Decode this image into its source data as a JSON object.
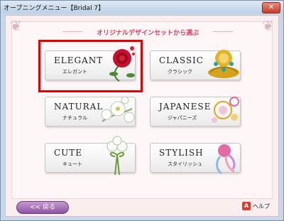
{
  "window": {
    "title": "オープニングメニュー【Bridal 7】",
    "close_label": "✕"
  },
  "heading": "オリジナルデザインセットから選ぶ",
  "tiles": [
    {
      "title": "ELEGANT",
      "subtitle": "エレガント",
      "selected": true,
      "icon": "red-rose-icon",
      "accent": "#c8102e"
    },
    {
      "title": "CLASSIC",
      "subtitle": "クラシック",
      "selected": false,
      "icon": "gold-ornament-icon",
      "accent": "#d4a21b"
    },
    {
      "title": "NATURAL",
      "subtitle": "ナチュラル",
      "selected": false,
      "icon": "white-flower-icon",
      "accent": "#7fa86a"
    },
    {
      "title": "JAPANESE",
      "subtitle": "ジャパニーズ",
      "selected": false,
      "icon": "japanese-flower-icon",
      "accent": "#e0a526"
    },
    {
      "title": "CUTE",
      "subtitle": "キュート",
      "selected": false,
      "icon": "bouquet-ribbon-icon",
      "accent": "#6e9b3c"
    },
    {
      "title": "STYLISH",
      "subtitle": "スタイリッシュ",
      "selected": false,
      "icon": "stylish-swirl-icon",
      "accent": "#e36aa5"
    }
  ],
  "footer": {
    "back_label": "<< 戻る",
    "help_label": "ヘルプ"
  },
  "colors": {
    "heading": "#e03c5c",
    "selection": "#e10000",
    "back_button": "#9a5fb0"
  }
}
